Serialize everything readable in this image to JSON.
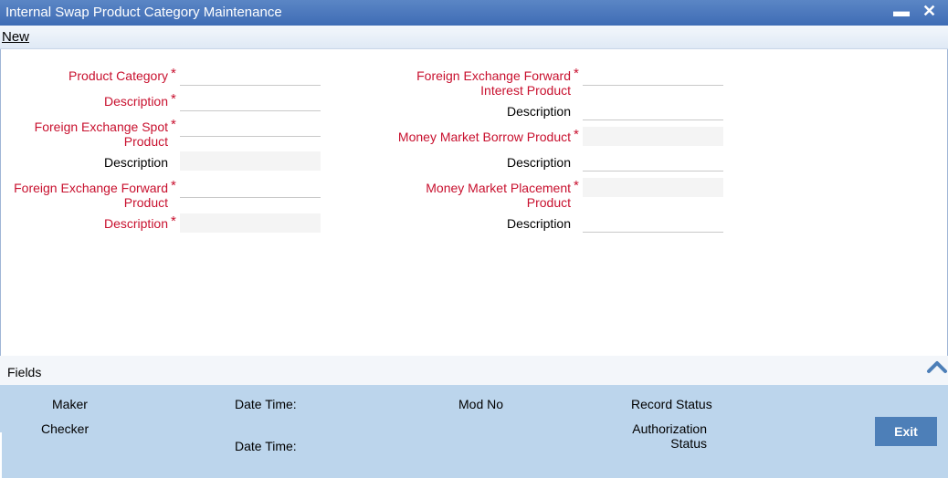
{
  "window": {
    "title": "Internal Swap Product Category Maintenance",
    "minimize_symbol": "▬",
    "close_symbol": "✕"
  },
  "toolbar": {
    "new_label": "New"
  },
  "form": {
    "left": {
      "product_category": {
        "label": "Product Category",
        "value": ""
      },
      "description_1": {
        "label": "Description",
        "value": ""
      },
      "fx_spot_product": {
        "label_line1": "Foreign Exchange Spot",
        "label_line2": "Product",
        "value": ""
      },
      "description_2": {
        "label": "Description",
        "value": ""
      },
      "fx_forward_product": {
        "label_line1": "Foreign Exchange Forward",
        "label_line2": "Product",
        "value": ""
      },
      "description_3": {
        "label": "Description",
        "value": ""
      }
    },
    "right": {
      "fx_forward_interest_product": {
        "label_line1": "Foreign Exchange Forward",
        "label_line2": "Interest Product",
        "value": ""
      },
      "description_4": {
        "label": "Description",
        "value": ""
      },
      "mm_borrow_product": {
        "label": "Money Market Borrow Product",
        "value": ""
      },
      "description_5": {
        "label": "Description",
        "value": ""
      },
      "mm_placement_product": {
        "label_line1": "Money Market Placement",
        "label_line2": "Product",
        "value": ""
      },
      "description_6": {
        "label": "Description",
        "value": ""
      }
    },
    "required_mark": "*"
  },
  "fields_bar": {
    "label": "Fields"
  },
  "audit": {
    "maker": "Maker",
    "checker": "Checker",
    "date_time_1": "Date Time:",
    "date_time_2": "Date Time:",
    "mod_no": "Mod No",
    "record_status": "Record Status",
    "authorization_line1": "Authorization",
    "authorization_line2": "Status"
  },
  "buttons": {
    "exit_label": "Exit"
  },
  "colors": {
    "titlebar": "#3e6cb5",
    "required_label": "#c8102e",
    "audit_panel": "#bcd5ec",
    "exit_button": "#4d7fb8"
  }
}
